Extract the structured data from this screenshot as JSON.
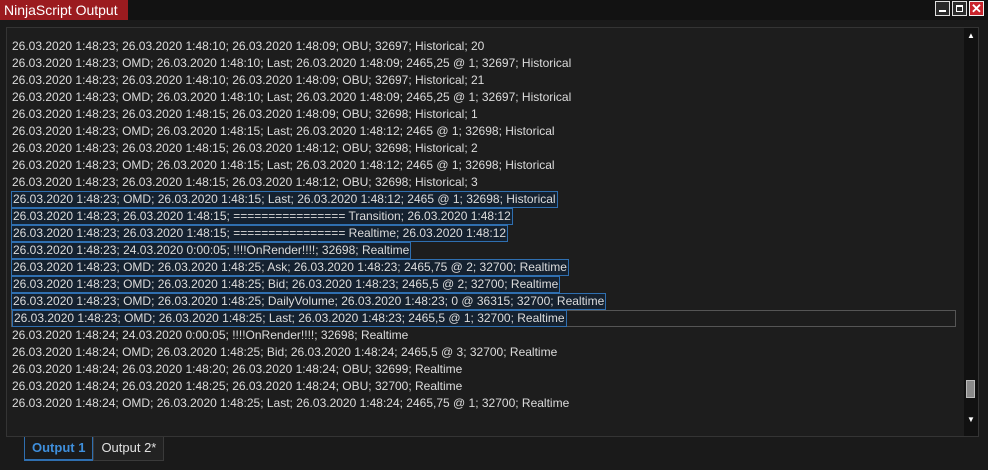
{
  "window": {
    "title": "NinjaScript Output",
    "controls": [
      "minimize",
      "maximize",
      "close"
    ],
    "accent_color": "#9b1b1f",
    "selection_color": "#2f6fb0"
  },
  "output": {
    "lines": [
      {
        "text": "26.03.2020 1:48:23; 26.03.2020 1:48:10; 26.03.2020 1:48:09; OBU; 32697; Historical; 20",
        "selected": false
      },
      {
        "text": "26.03.2020 1:48:23; OMD; 26.03.2020 1:48:10; Last; 26.03.2020 1:48:09; 2465,25 @ 1; 32697; Historical",
        "selected": false
      },
      {
        "text": "26.03.2020 1:48:23; 26.03.2020 1:48:10; 26.03.2020 1:48:09; OBU; 32697; Historical; 21",
        "selected": false
      },
      {
        "text": "26.03.2020 1:48:23; OMD; 26.03.2020 1:48:10; Last; 26.03.2020 1:48:09; 2465,25 @ 1; 32697; Historical",
        "selected": false
      },
      {
        "text": "26.03.2020 1:48:23; 26.03.2020 1:48:15; 26.03.2020 1:48:09; OBU; 32698; Historical; 1",
        "selected": false
      },
      {
        "text": "26.03.2020 1:48:23; OMD; 26.03.2020 1:48:15; Last; 26.03.2020 1:48:12; 2465 @ 1; 32698; Historical",
        "selected": false
      },
      {
        "text": "26.03.2020 1:48:23; 26.03.2020 1:48:15; 26.03.2020 1:48:12; OBU; 32698; Historical; 2",
        "selected": false
      },
      {
        "text": "26.03.2020 1:48:23; OMD; 26.03.2020 1:48:15; Last; 26.03.2020 1:48:12; 2465 @ 1; 32698; Historical",
        "selected": false
      },
      {
        "text": "26.03.2020 1:48:23; 26.03.2020 1:48:15; 26.03.2020 1:48:12; OBU; 32698; Historical; 3",
        "selected": false
      },
      {
        "text": "26.03.2020 1:48:23; OMD; 26.03.2020 1:48:15; Last; 26.03.2020 1:48:12; 2465 @ 1; 32698; Historical",
        "selected": true
      },
      {
        "text": "26.03.2020 1:48:23; 26.03.2020 1:48:15; ================ Transition; 26.03.2020 1:48:12",
        "selected": true
      },
      {
        "text": "26.03.2020 1:48:23; 26.03.2020 1:48:15; ================ Realtime; 26.03.2020 1:48:12",
        "selected": true
      },
      {
        "text": "26.03.2020 1:48:23; 24.03.2020 0:00:05; !!!!OnRender!!!!; 32698; Realtime",
        "selected": true
      },
      {
        "text": "26.03.2020 1:48:23; OMD; 26.03.2020 1:48:25; Ask; 26.03.2020 1:48:23; 2465,75 @ 2; 32700; Realtime",
        "selected": true
      },
      {
        "text": "26.03.2020 1:48:23; OMD; 26.03.2020 1:48:25; Bid; 26.03.2020 1:48:23; 2465,5 @ 2; 32700; Realtime",
        "selected": true
      },
      {
        "text": "26.03.2020 1:48:23; OMD; 26.03.2020 1:48:25; DailyVolume; 26.03.2020 1:48:23; 0 @ 36315; 32700; Realtime",
        "selected": true
      },
      {
        "text": "26.03.2020 1:48:23; OMD; 26.03.2020 1:48:25; Last; 26.03.2020 1:48:23; 2465,5 @ 1; 32700; Realtime",
        "selected": true,
        "caret": true
      },
      {
        "text": "26.03.2020 1:48:24; 24.03.2020 0:00:05; !!!!OnRender!!!!; 32698; Realtime",
        "selected": false
      },
      {
        "text": "26.03.2020 1:48:24; OMD; 26.03.2020 1:48:25; Bid; 26.03.2020 1:48:24; 2465,5 @ 3; 32700; Realtime",
        "selected": false
      },
      {
        "text": "26.03.2020 1:48:24; 26.03.2020 1:48:20; 26.03.2020 1:48:24; OBU; 32699; Realtime",
        "selected": false
      },
      {
        "text": "26.03.2020 1:48:24; 26.03.2020 1:48:25; 26.03.2020 1:48:24; OBU; 32700; Realtime",
        "selected": false
      },
      {
        "text": "26.03.2020 1:48:24; OMD; 26.03.2020 1:48:25; Last; 26.03.2020 1:48:24; 2465,75 @ 1; 32700; Realtime",
        "selected": false
      }
    ]
  },
  "tabs": [
    {
      "label": "Output 1",
      "active": true
    },
    {
      "label": "Output 2*",
      "active": false
    }
  ]
}
